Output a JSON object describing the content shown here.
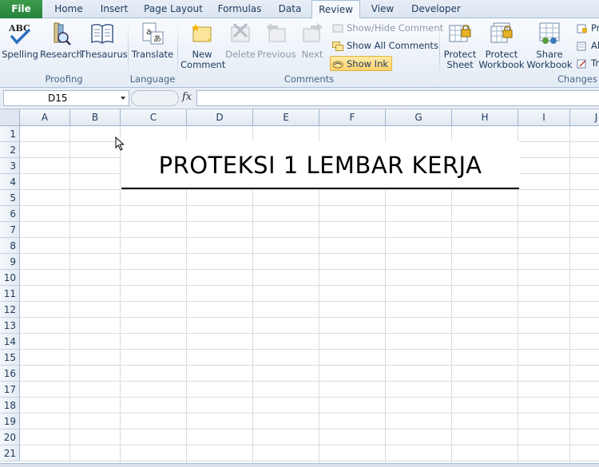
{
  "tabs": [
    {
      "label": "File",
      "key": "file"
    },
    {
      "label": "Home",
      "key": "home"
    },
    {
      "label": "Insert",
      "key": "insert"
    },
    {
      "label": "Page Layout",
      "key": "page-layout"
    },
    {
      "label": "Formulas",
      "key": "formulas"
    },
    {
      "label": "Data",
      "key": "data"
    },
    {
      "label": "Review",
      "key": "review",
      "active": true
    },
    {
      "label": "View",
      "key": "view"
    },
    {
      "label": "Developer",
      "key": "developer"
    }
  ],
  "ribbon": {
    "proofing": {
      "group_label": "Proofing",
      "spelling": "Spelling",
      "research": "Research",
      "thesaurus": "Thesaurus"
    },
    "language": {
      "group_label": "Language",
      "translate": "Translate"
    },
    "comments": {
      "group_label": "Comments",
      "new_comment_line1": "New",
      "new_comment_line2": "Comment",
      "delete": "Delete",
      "previous": "Previous",
      "next": "Next",
      "show_hide_comment": "Show/Hide Comment",
      "show_all_comments": "Show All Comments",
      "show_ink": "Show Ink"
    },
    "changes": {
      "group_label": "Changes",
      "protect_sheet_line1": "Protect",
      "protect_sheet_line2": "Sheet",
      "protect_workbook_line1": "Protect",
      "protect_workbook_line2": "Workbook",
      "share_workbook_line1": "Share",
      "share_workbook_line2": "Workbook",
      "small_1": "Pr",
      "small_2": "Al",
      "small_3": "Tr"
    },
    "spelling_icon_text": "ABC"
  },
  "formula_bar": {
    "name_box": "D15",
    "fx_label": "fx",
    "formula": ""
  },
  "grid": {
    "columns": [
      "A",
      "B",
      "C",
      "D",
      "E",
      "F",
      "G",
      "H",
      "I",
      "J"
    ],
    "rows": [
      "1",
      "2",
      "3",
      "4",
      "5",
      "6",
      "7",
      "8",
      "9",
      "10",
      "11",
      "12",
      "13",
      "14",
      "15",
      "16",
      "17",
      "18",
      "19",
      "20",
      "21"
    ],
    "merged_title": "PROTEKSI 1 LEMBAR KERJA"
  },
  "colors": {
    "file_tab": "#2f8f42",
    "ribbon_text": "#1e395b",
    "gridline": "#dadcdd",
    "show_ink_highlight": "#ffd36e"
  }
}
